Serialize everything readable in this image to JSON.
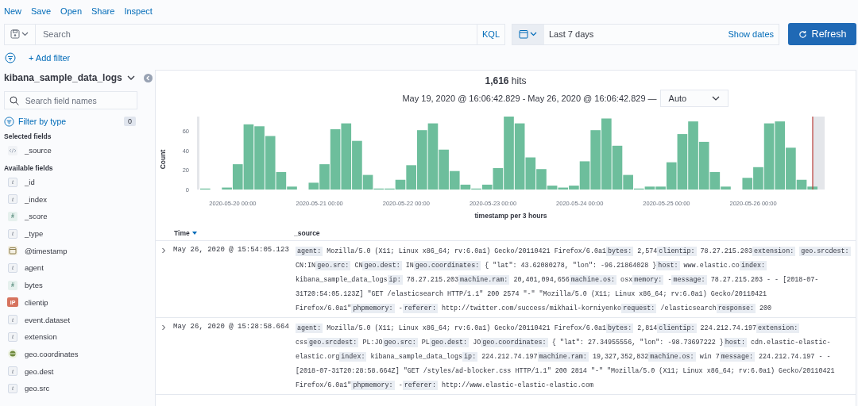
{
  "top_menu": [
    "New",
    "Save",
    "Open",
    "Share",
    "Inspect"
  ],
  "query_bar": {
    "placeholder": "Search",
    "language": "KQL"
  },
  "date_picker": {
    "value": "Last 7 days",
    "show_dates": "Show dates"
  },
  "refresh_button": "Refresh",
  "add_filter": "+ Add filter",
  "sidebar": {
    "index_pattern": "kibana_sample_data_logs",
    "search": {
      "placeholder": "Search field names"
    },
    "filter_by_type": "Filter by type",
    "filter_count": "0",
    "selected_heading": "Selected fields",
    "selected_fields": [
      {
        "name": "_source",
        "kind": "source"
      }
    ],
    "available_heading": "Available fields",
    "available_fields": [
      {
        "name": "_id",
        "kind": "string",
        "glyph": "t"
      },
      {
        "name": "_index",
        "kind": "string",
        "glyph": "t"
      },
      {
        "name": "_score",
        "kind": "number",
        "glyph": "#"
      },
      {
        "name": "_type",
        "kind": "string",
        "glyph": "t"
      },
      {
        "name": "@timestamp",
        "kind": "date"
      },
      {
        "name": "agent",
        "kind": "string",
        "glyph": "t"
      },
      {
        "name": "bytes",
        "kind": "number",
        "glyph": "#"
      },
      {
        "name": "clientip",
        "kind": "ip",
        "glyph": "IP"
      },
      {
        "name": "event.dataset",
        "kind": "string",
        "glyph": "t"
      },
      {
        "name": "extension",
        "kind": "string",
        "glyph": "t"
      },
      {
        "name": "geo.coordinates",
        "kind": "geo"
      },
      {
        "name": "geo.dest",
        "kind": "string",
        "glyph": "t"
      },
      {
        "name": "geo.src",
        "kind": "string",
        "glyph": "t"
      }
    ]
  },
  "hits": {
    "count": "1,616",
    "label": "hits"
  },
  "time_range": "May 19, 2020 @ 16:06:42.829 - May 26, 2020 @ 16:06:42.829 —",
  "interval": "Auto",
  "chart_data": {
    "type": "bar",
    "xlabel": "timestamp per 3 hours",
    "ylabel": "Count",
    "categories": [
      null,
      null,
      null,
      "2020-05-20 00:00",
      null,
      null,
      null,
      null,
      null,
      null,
      null,
      "2020-05-21 00:00",
      null,
      null,
      null,
      null,
      null,
      null,
      null,
      "2020-05-22 00:00",
      null,
      null,
      null,
      null,
      null,
      null,
      null,
      "2020-05-23 00:00",
      null,
      null,
      null,
      null,
      null,
      null,
      null,
      "2020-05-24 00:00",
      null,
      null,
      null,
      null,
      null,
      null,
      null,
      "2020-05-25 00:00",
      null,
      null,
      null,
      null,
      null,
      null,
      null,
      "2020-05-26 00:00",
      null,
      null,
      null,
      null,
      null
    ],
    "values": [
      1,
      0,
      2,
      26,
      67,
      65,
      55,
      18,
      3,
      0,
      7,
      26,
      62,
      68,
      50,
      15,
      1,
      1,
      10,
      25,
      61,
      68,
      41,
      19,
      5,
      1,
      5,
      22,
      75,
      68,
      33,
      21,
      4,
      2,
      4,
      29,
      61,
      73,
      45,
      15,
      1,
      3,
      3,
      28,
      57,
      70,
      49,
      18,
      3,
      0,
      12,
      23,
      68,
      70,
      43,
      10,
      3
    ],
    "ylim": [
      0,
      75
    ],
    "yticks": [
      0,
      20,
      40,
      60
    ]
  },
  "table": {
    "columns": [
      {
        "label": "Time",
        "sorted": true
      },
      {
        "label": "_source",
        "sorted": false
      }
    ],
    "rows": [
      {
        "time": "May 26, 2020 @ 15:54:05.123",
        "expanded": false,
        "source": [
          {
            "key": "agent:",
            "value": "Mozilla/5.0 (X11; Linux x86_64; rv:6.0a1) Gecko/20110421 Firefox/6.0a1"
          },
          {
            "key": "bytes:",
            "value": "2,574"
          },
          {
            "key": "clientip:",
            "value": "78.27.215.203"
          },
          {
            "key": "extension:"
          },
          {
            "key": "geo.srcdest:",
            "value": "CN:IN"
          },
          {
            "key": "geo.src:",
            "value": "CN"
          },
          {
            "key": "geo.dest:",
            "value": "IN"
          },
          {
            "key": "geo.coordinates:",
            "value": "{ \"lat\": 43.62080278, \"lon\": -96.21864028 }"
          },
          {
            "key": "host:",
            "value": "www.elastic.co"
          },
          {
            "key": "index:",
            "value": "kibana_sample_data_logs"
          },
          {
            "key": "ip:",
            "value": "78.27.215.203"
          },
          {
            "key": "machine.ram:",
            "value": "20,401,094,656"
          },
          {
            "key": "machine.os:",
            "value": "osx"
          },
          {
            "key": "memory:",
            "value": " -"
          },
          {
            "key": "message:",
            "value": "78.27.215.203 - - [2018-07-31T20:54:05.123Z] \"GET /elasticsearch HTTP/1.1\" 200 2574 \"-\" \"Mozilla/5.0 (X11; Linux x86_64; rv:6.0a1) Gecko/20110421 Firefox/6.0a1\""
          },
          {
            "key": "phpmemory:",
            "value": " -"
          },
          {
            "key": "referer:",
            "value": "http://twitter.com/success/mikhail-korniyenko"
          },
          {
            "key": "request:",
            "value": "/elasticsearch"
          },
          {
            "key": "response:",
            "value": "200"
          }
        ]
      },
      {
        "time": "May 26, 2020 @ 15:28:58.664",
        "expanded": false,
        "source": [
          {
            "key": "agent:",
            "value": "Mozilla/5.0 (X11; Linux x86_64; rv:6.0a1) Gecko/20110421 Firefox/6.0a1"
          },
          {
            "key": "bytes:",
            "value": "2,814"
          },
          {
            "key": "clientip:",
            "value": "224.212.74.197"
          },
          {
            "key": "extension:",
            "value": "css"
          },
          {
            "key": "geo.srcdest:",
            "value": "PL:JO"
          },
          {
            "key": "geo.src:",
            "value": "PL"
          },
          {
            "key": "geo.dest:",
            "value": "JO"
          },
          {
            "key": "geo.coordinates:",
            "value": "{ \"lat\": 27.34955556, \"lon\": -98.73697222 }"
          },
          {
            "key": "host:",
            "value": "cdn.elastic-elastic-elastic.org"
          },
          {
            "key": "index:",
            "value": "kibana_sample_data_logs"
          },
          {
            "key": "ip:",
            "value": "224.212.74.197"
          },
          {
            "key": "machine.ram:",
            "value": "19,327,352,832"
          },
          {
            "key": "machine.os:",
            "value": "win 7"
          },
          {
            "key": "message:",
            "value": "224.212.74.197 - - [2018-07-31T20:28:58.664Z] \"GET /styles/ad-blocker.css HTTP/1.1\" 200 2814 \"-\" \"Mozilla/5.0 (X11; Linux x86_64; rv:6.0a1) Gecko/20110421 Firefox/6.0a1\""
          },
          {
            "key": "phpmemory:",
            "value": " -"
          },
          {
            "key": "referer:",
            "value": "http://www.elastic-elastic-elastic.com"
          }
        ]
      }
    ]
  }
}
